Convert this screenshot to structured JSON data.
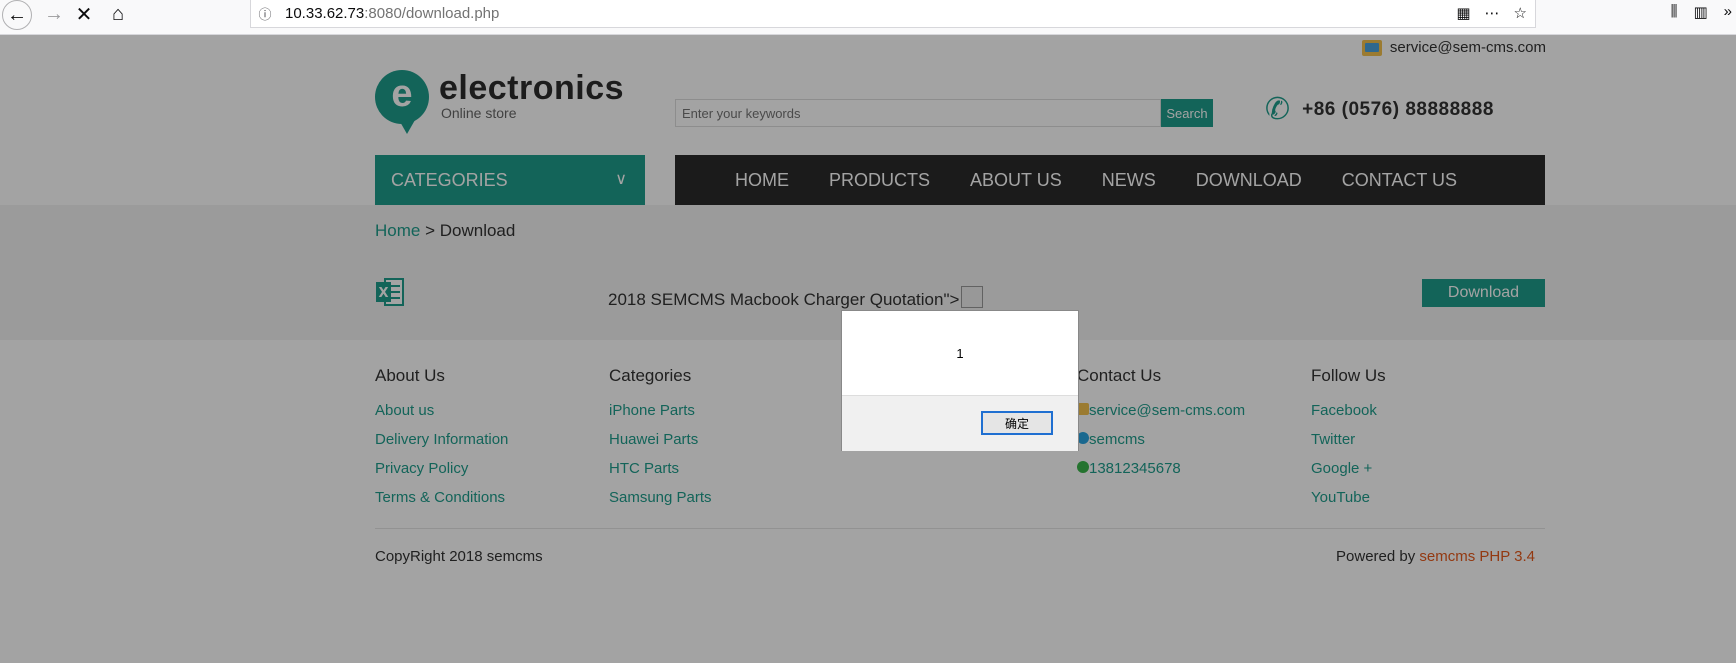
{
  "browser": {
    "url_host": "10.33.62.73",
    "url_rest": ":8080/download.php"
  },
  "header": {
    "email": "service@sem-cms.com",
    "logo_letter": "e",
    "logo_name": "electronics",
    "logo_sub": "Online store",
    "search_placeholder": "Enter your keywords",
    "search_button": "Search",
    "phone": "+86  (0576)  88888888"
  },
  "categories_label": "CATEGORIES",
  "nav": [
    "HOME",
    "PRODUCTS",
    "ABOUT US",
    "NEWS",
    "DOWNLOAD",
    "CONTACT US"
  ],
  "breadcrumb": {
    "home": "Home",
    "sep": " > ",
    "current": "Download"
  },
  "download_item": {
    "title": "2018 SEMCMS Macbook Charger Quotation\">",
    "button": "Download"
  },
  "footer": {
    "about": {
      "heading": "About Us",
      "links": [
        "About us",
        "Delivery Information",
        "Privacy Policy",
        "Terms & Conditions"
      ]
    },
    "categories": {
      "heading": "Categories",
      "links": [
        "iPhone Parts",
        "Huawei Parts",
        "HTC Parts",
        "Samsung Parts"
      ]
    },
    "contact": {
      "heading": "Contact Us",
      "email": "service@sem-cms.com",
      "skype": "semcms",
      "whatsapp": "13812345678"
    },
    "follow": {
      "heading": "Follow Us",
      "links": [
        "Facebook",
        "Twitter",
        "Google +",
        "YouTube"
      ]
    },
    "copyright": "CopyRight 2018 semcms",
    "powered_prefix": "Powered by ",
    "powered_link": "semcms PHP 3.4"
  },
  "alert": {
    "message": "1",
    "ok": "确定"
  },
  "colors": {
    "accent": "#1f9d8c",
    "nav_bg": "#2b2b2b",
    "powered": "#e65a1c"
  }
}
